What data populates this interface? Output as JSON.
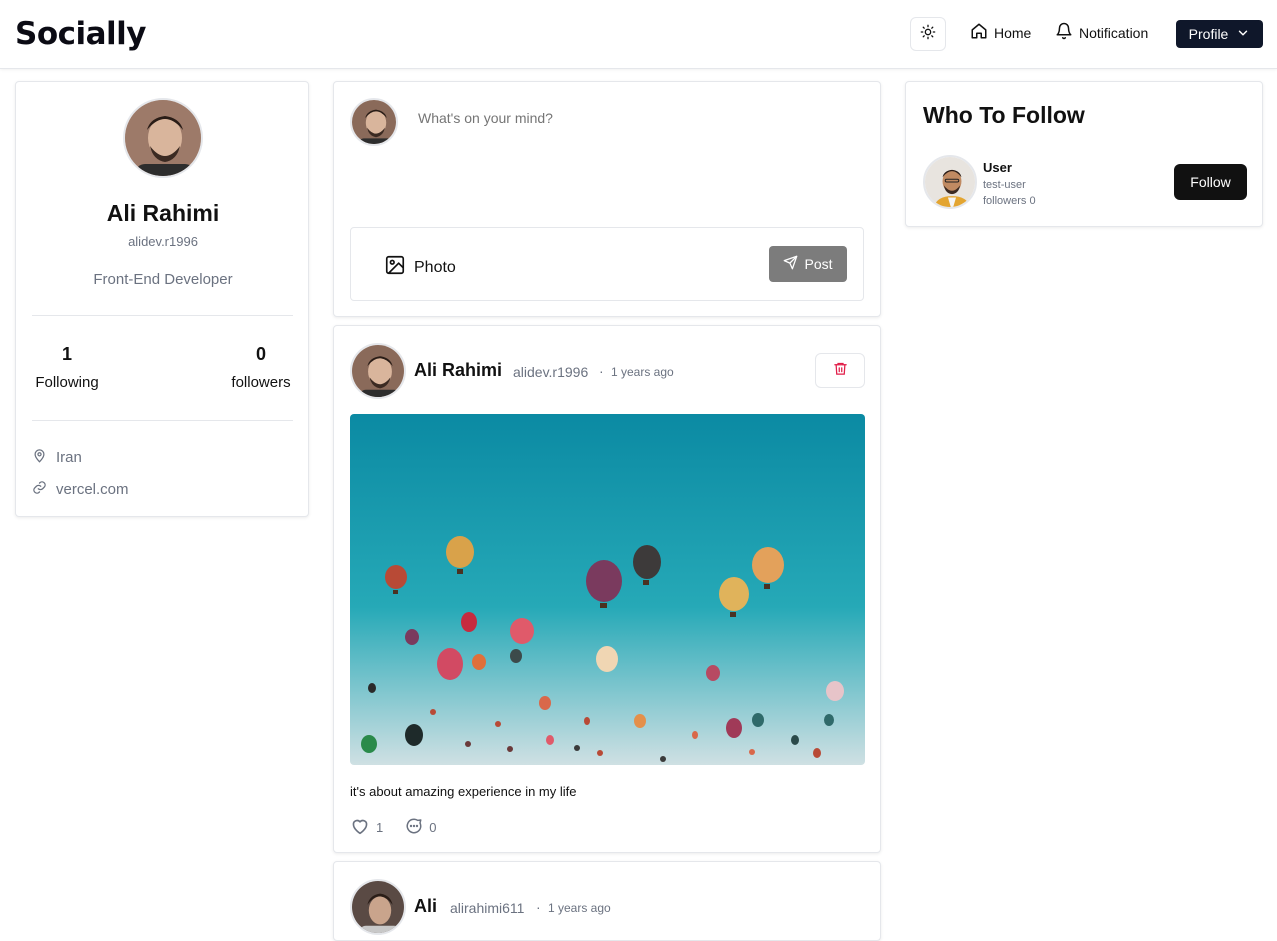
{
  "app": {
    "brand": "Socially"
  },
  "nav": {
    "theme_icon": "sun-icon",
    "home_label": "Home",
    "notification_label": "Notification",
    "profile_label": "Profile"
  },
  "profile": {
    "name": "Ali Rahimi",
    "handle": "alidev.r1996",
    "bio": "Front-End Developer",
    "following_count": "1",
    "following_label": "Following",
    "followers_count": "0",
    "followers_label": "followers",
    "location": "Iran",
    "website": "vercel.com"
  },
  "composer": {
    "placeholder": "What's on your mind?",
    "photo_label": "Photo",
    "post_label": "Post"
  },
  "posts": [
    {
      "author_name": "Ali Rahimi",
      "author_handle": "alidev.r1996",
      "separator": "·",
      "time": "1 years ago",
      "text": "it's about amazing experience in my life",
      "likes": "1",
      "comments": "0"
    },
    {
      "author_name": "Ali",
      "author_handle": "alirahimi611",
      "separator": "·",
      "time": "1 years ago"
    }
  ],
  "who_to_follow": {
    "title": "Who To Follow",
    "users": [
      {
        "name": "User",
        "handle": "test-user",
        "followers": "followers 0",
        "button_label": "Follow"
      }
    ]
  },
  "colors": {
    "primary_dark": "#0f172a",
    "delete_red": "#e11d48",
    "muted_text": "#6b7280",
    "sky_top": "#0b8aa3",
    "sky_bottom": "#cfe0e3"
  }
}
